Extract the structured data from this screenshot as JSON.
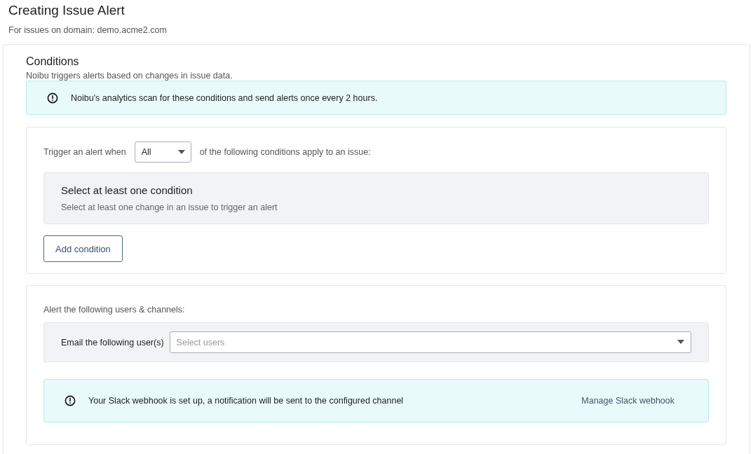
{
  "header": {
    "title": "Creating Issue Alert",
    "subtitle": "For issues on domain: demo.acme2.com"
  },
  "conditions": {
    "title": "Conditions",
    "description": "Noibu triggers alerts based on changes in issue data.",
    "notice": "Noibu's analytics scan for these conditions and send alerts once every 2 hours.",
    "trigger": {
      "prefix": "Trigger an alert when",
      "select_value": "All",
      "suffix": "of the following conditions apply to an issue:"
    },
    "empty_state": {
      "title": "Select at least one condition",
      "text": "Select at least one change in an issue to trigger an alert"
    },
    "add_button": "Add condition"
  },
  "recipients": {
    "label": "Alert the following users & channels:",
    "email_label": "Email the following user(s)",
    "email_placeholder": "Select users",
    "slack_notice": "Your Slack webhook is set up, a notification will be sent to the configured channel",
    "slack_link": "Manage Slack webhook"
  }
}
